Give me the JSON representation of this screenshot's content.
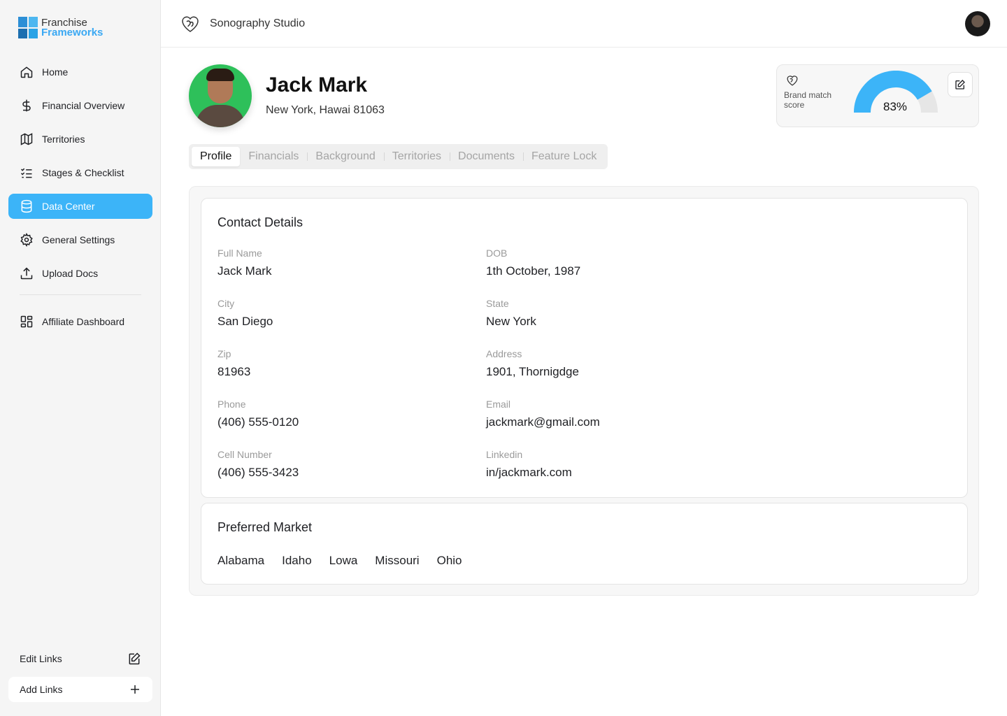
{
  "brand": {
    "line1": "Franchise",
    "line2": "Frameworks"
  },
  "sidebar": {
    "items": [
      {
        "label": "Home",
        "icon": "home-icon"
      },
      {
        "label": "Financial Overview",
        "icon": "dollar-icon"
      },
      {
        "label": "Territories",
        "icon": "map-icon"
      },
      {
        "label": "Stages & Checklist",
        "icon": "checklist-icon"
      },
      {
        "label": "Data Center",
        "icon": "database-icon",
        "active": true
      },
      {
        "label": "General Settings",
        "icon": "gear-icon"
      },
      {
        "label": "Upload Docs",
        "icon": "upload-icon"
      }
    ],
    "secondary": [
      {
        "label": "Affiliate Dashboard",
        "icon": "dashboard-icon"
      }
    ],
    "edit_links": "Edit Links",
    "add_links": "Add Links"
  },
  "header": {
    "studio_name": "Sonography Studio"
  },
  "profile": {
    "name": "Jack Mark",
    "location": "New York, Hawai 81063",
    "match": {
      "label": "Brand match score",
      "value": "83%",
      "percent": 83,
      "color": "#3cb4f8",
      "track_color": "#e6e6e6"
    }
  },
  "tabs": [
    "Profile",
    "Financials",
    "Background",
    "Territories",
    "Documents",
    "Feature Lock"
  ],
  "active_tab": "Profile",
  "contact": {
    "title": "Contact Details",
    "fields": {
      "full_name": {
        "label": "Full Name",
        "value": "Jack Mark"
      },
      "dob": {
        "label": "DOB",
        "value": "1th October, 1987"
      },
      "city": {
        "label": "City",
        "value": "San Diego"
      },
      "state": {
        "label": "State",
        "value": "New York"
      },
      "zip": {
        "label": "Zip",
        "value": "81963"
      },
      "address": {
        "label": "Address",
        "value": "1901, Thornigdge"
      },
      "phone": {
        "label": "Phone",
        "value": "(406) 555-0120"
      },
      "email": {
        "label": "Email",
        "value": "jackmark@gmail.com"
      },
      "cell": {
        "label": "Cell Number",
        "value": "(406) 555-3423"
      },
      "linkedin": {
        "label": "Linkedin",
        "value": "in/jackmark.com"
      }
    }
  },
  "market": {
    "title": "Preferred Market",
    "items": [
      "Alabama",
      "Idaho",
      "Lowa",
      "Missouri",
      "Ohio"
    ]
  },
  "colors": {
    "accent": "#3cb4f8",
    "avatar_bg": "#2ec05a"
  }
}
